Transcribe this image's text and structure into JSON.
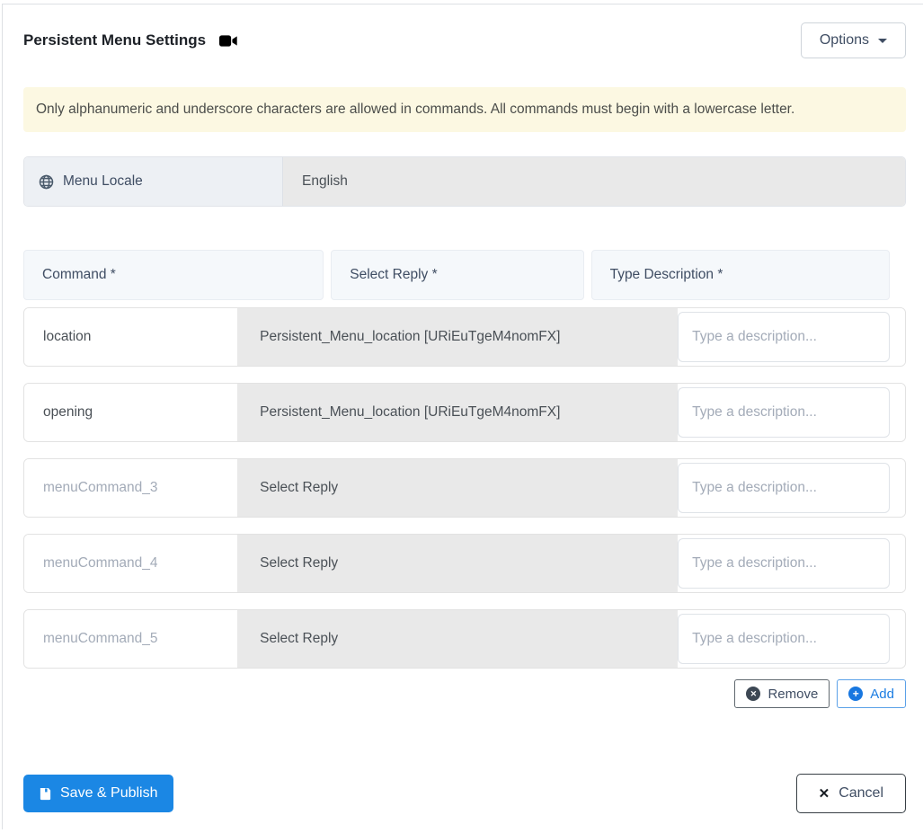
{
  "header": {
    "title": "Persistent Menu Settings",
    "options_label": "Options"
  },
  "banner": {
    "text": "Only alphanumeric and underscore characters are allowed in commands. All commands must begin with a lowercase letter."
  },
  "locale": {
    "label": "Menu Locale",
    "value": "English",
    "icon": "globe-icon"
  },
  "table": {
    "headers": [
      "Command *",
      "Select Reply *",
      "Type Description *"
    ],
    "rows": [
      {
        "command": "location",
        "reply": "Persistent_Menu_location [URiEuTgeM4nomFX]",
        "description_placeholder": "Type a description..."
      },
      {
        "command": "opening",
        "reply": "Persistent_Menu_location [URiEuTgeM4nomFX]",
        "description_placeholder": "Type a description..."
      },
      {
        "command": "menuCommand_3",
        "reply": "Select Reply",
        "description_placeholder": "Type a description..."
      },
      {
        "command": "menuCommand_4",
        "reply": "Select Reply",
        "description_placeholder": "Type a description..."
      },
      {
        "command": "menuCommand_5",
        "reply": "Select Reply",
        "description_placeholder": "Type a description..."
      }
    ],
    "remove_label": "Remove",
    "add_label": "Add"
  },
  "footer": {
    "save_label": "Save & Publish",
    "cancel_label": "Cancel"
  },
  "icons": {
    "camera": "video-camera-icon",
    "remove_x": "✕",
    "add_plus": "+",
    "cancel_x": "✕"
  },
  "colors": {
    "primary_blue": "#1b87e4",
    "banner_bg": "#fcf8e2",
    "disabled_gray": "#e9e9e9",
    "header_cell_bg": "#f5f8fb",
    "dark_text": "#3f4d63"
  }
}
